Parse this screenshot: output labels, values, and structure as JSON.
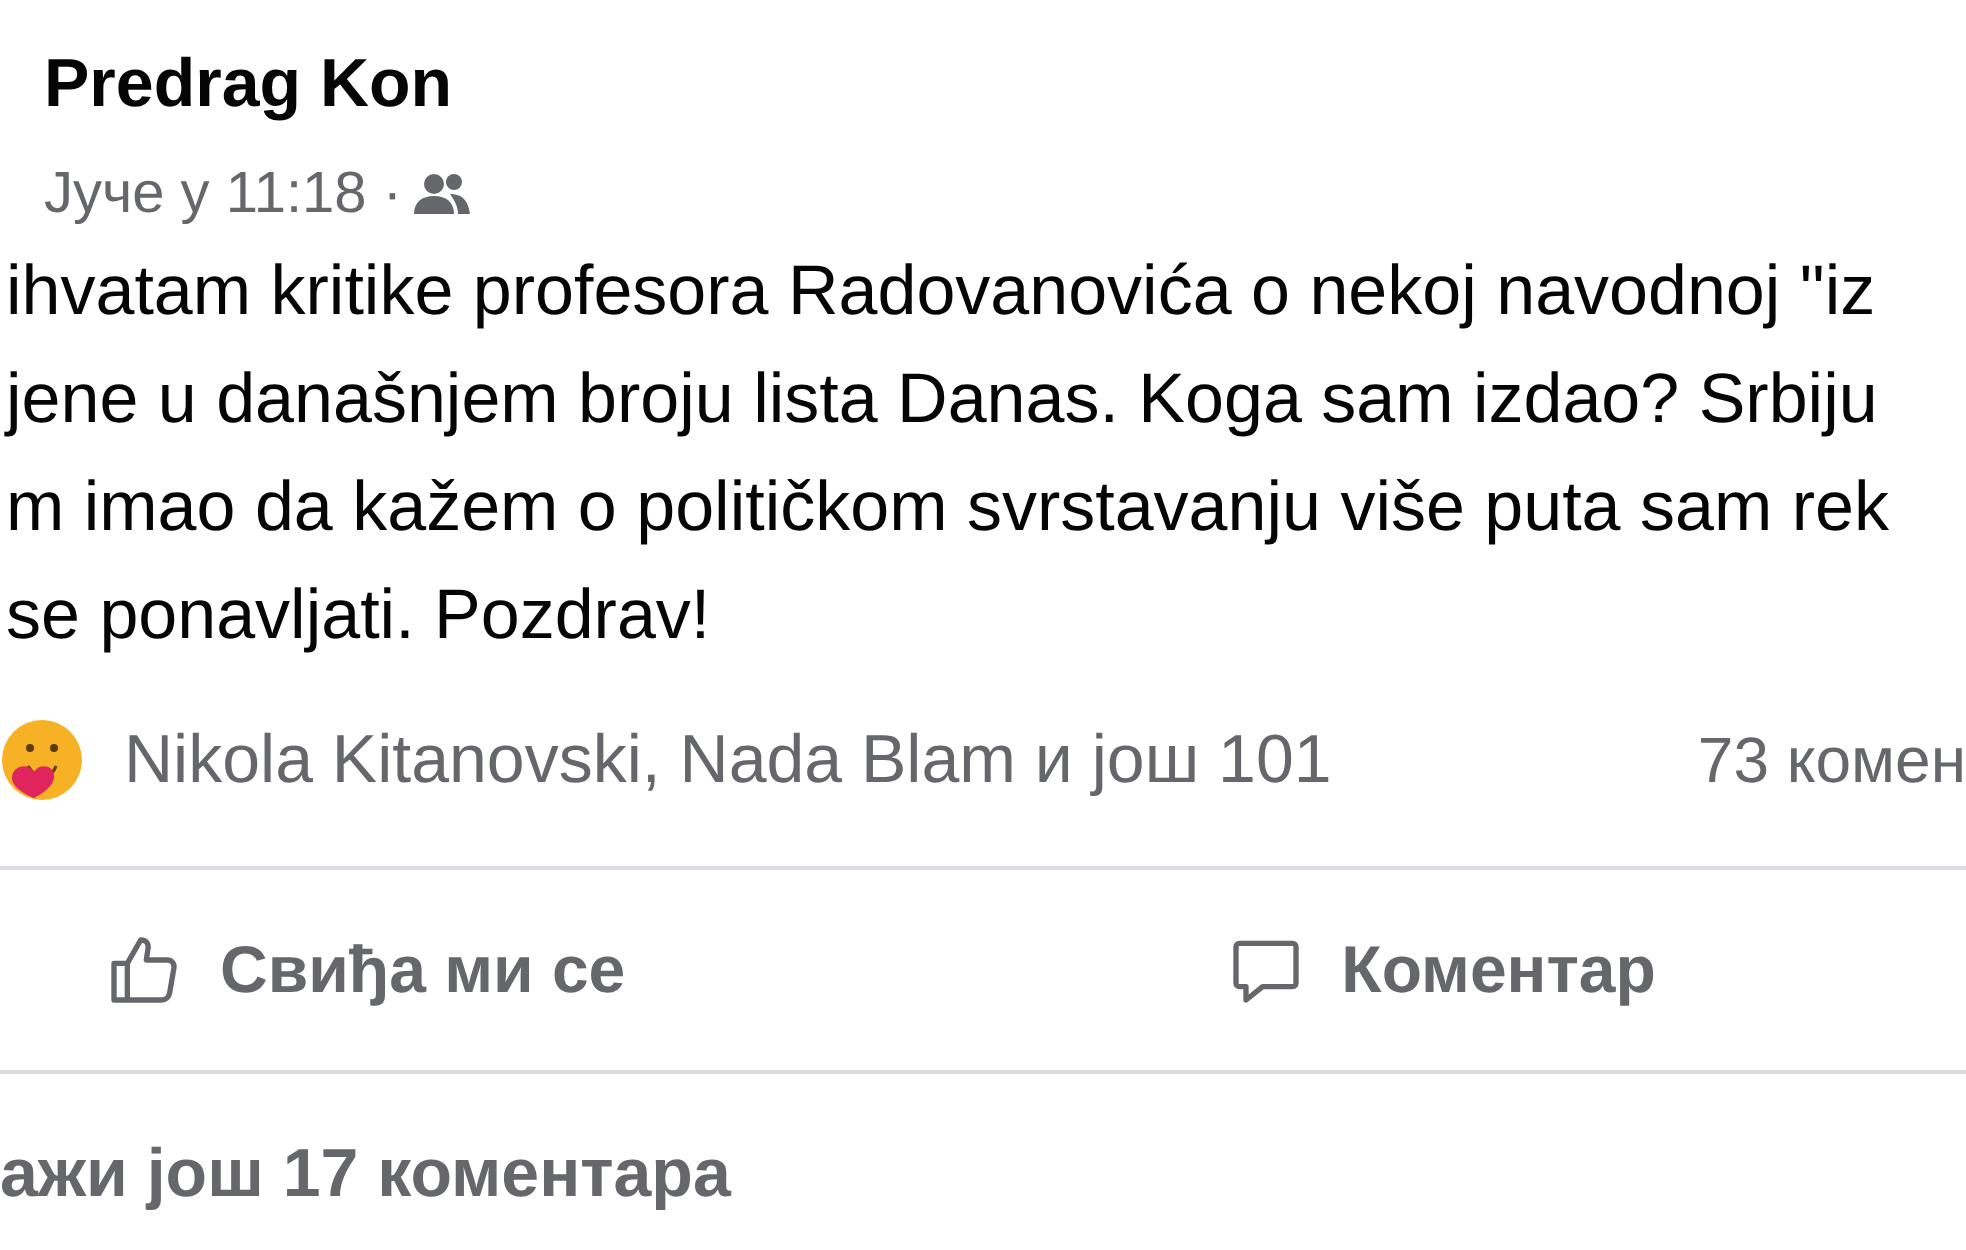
{
  "post": {
    "author": "Predrag Kon",
    "time": "Јуче у 11:18 ·",
    "body_lines": [
      "ihvatam kritike profesora Radovanovića o nekoj navodnoj \"iz",
      "jene u današnjem broju lista Danas. Koga sam izdao? Srbiju",
      "m imao da kažem o političkom svrstavanju više puta sam rek",
      "se ponavljati. Pozdrav!"
    ]
  },
  "reactions": {
    "names": "Nikola Kitanovski, Nada Blam и још 101",
    "comments_count": "73 комен"
  },
  "actions": [
    {
      "kind": "like",
      "label": "Свиђа ми се"
    },
    {
      "kind": "comment",
      "label": "Коментар"
    }
  ],
  "more_comments": "ажи још 17 коментара"
}
